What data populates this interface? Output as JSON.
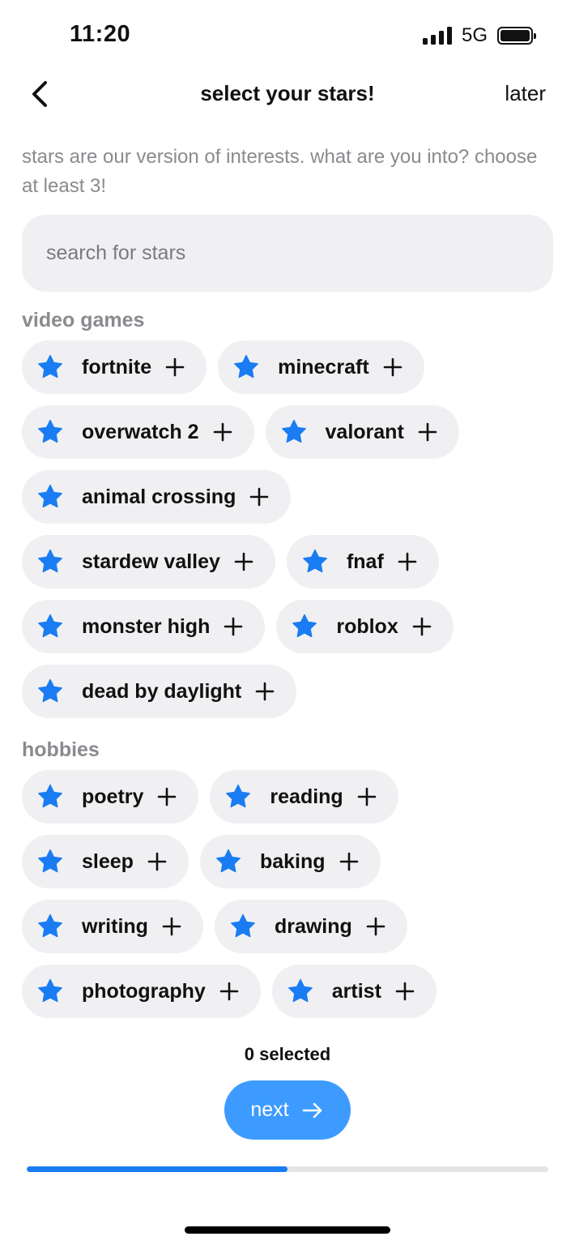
{
  "status_bar": {
    "time": "11:20",
    "network": "5G"
  },
  "nav": {
    "title": "select your stars!",
    "later_label": "later"
  },
  "subtitle": "stars are our version of interests. what are you into? choose at least 3!",
  "search": {
    "placeholder": "search for stars",
    "value": ""
  },
  "sections": [
    {
      "title": "video games",
      "rows": [
        [
          "fortnite",
          "minecraft"
        ],
        [
          "overwatch 2",
          "valorant"
        ],
        [
          "animal crossing"
        ],
        [
          "stardew valley",
          "fnaf"
        ],
        [
          "monster high",
          "roblox"
        ],
        [
          "dead by daylight"
        ]
      ]
    },
    {
      "title": "hobbies",
      "rows": [
        [
          "poetry",
          "reading"
        ],
        [
          "sleep",
          "baking"
        ],
        [
          "writing",
          "drawing"
        ],
        [
          "photography",
          "artist"
        ]
      ]
    }
  ],
  "chip_icons": {
    "leading": "star-icon",
    "trailing": "plus-icon"
  },
  "footer": {
    "selected_text": "0 selected",
    "next_label": "next"
  },
  "progress": {
    "fraction": 0.5
  },
  "colors": {
    "accent": "#1a7cf2",
    "next_button": "#3d9bff",
    "chip_bg": "#f0f0f3"
  }
}
